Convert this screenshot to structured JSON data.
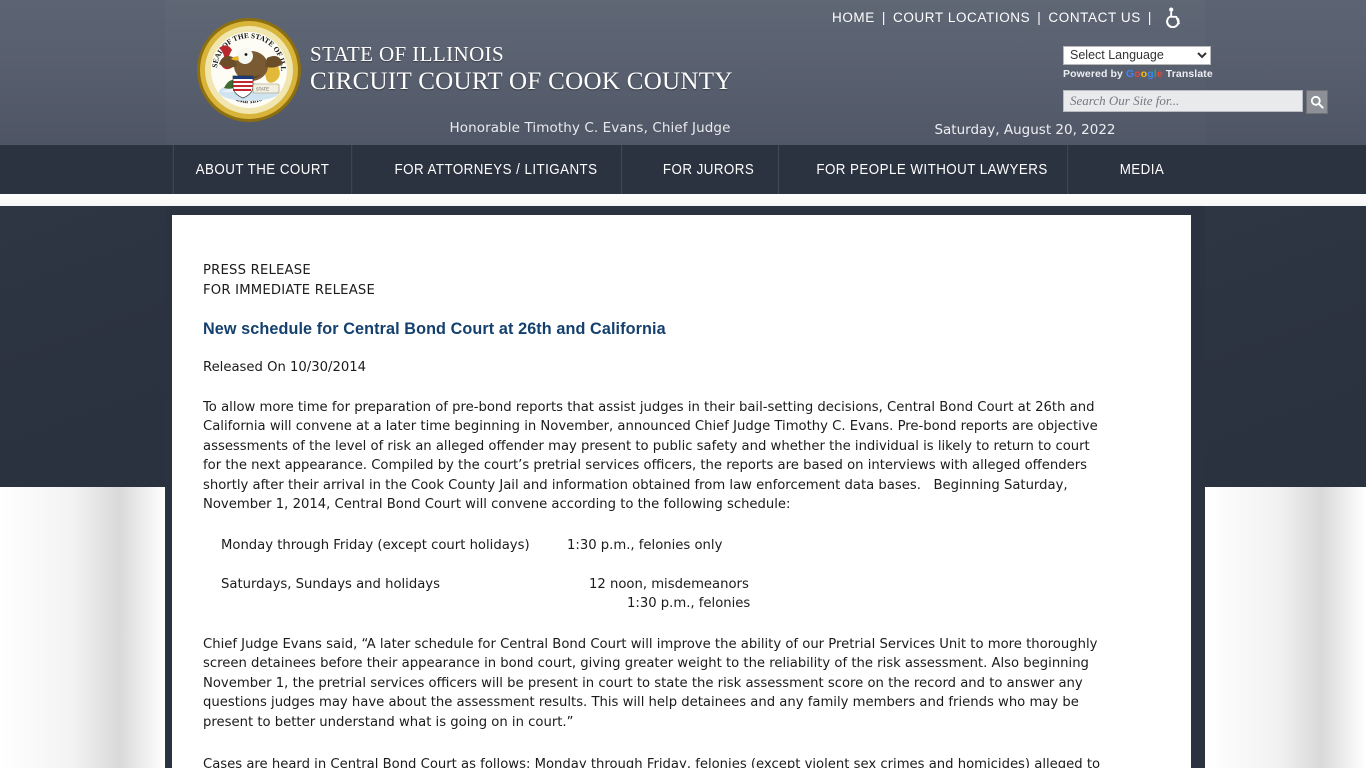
{
  "header": {
    "seal_alt": "Seal of the State of Illinois",
    "title_line1": "STATE OF ILLINOIS",
    "title_line2": "CIRCUIT COURT OF COOK COUNTY",
    "judge_line": "Honorable Timothy C. Evans, Chief Judge",
    "date": "Saturday, August 20, 2022",
    "top_links": [
      {
        "label": "HOME"
      },
      {
        "label": "COURT LOCATIONS"
      },
      {
        "label": "CONTACT US"
      }
    ],
    "separator": "|",
    "accessibility_icon": "wheelchair-accessibility-icon",
    "language": {
      "selected": "Select Language",
      "options": [
        "Select Language"
      ],
      "powered_by_prefix": "Powered by ",
      "google_letters": [
        "G",
        "o",
        "o",
        "g",
        "l",
        "e"
      ],
      "translate_label": " Translate"
    },
    "search": {
      "placeholder": "Search Our Site for...",
      "value": "",
      "button_icon": "search-icon"
    }
  },
  "nav": {
    "items": [
      {
        "label": "ABOUT THE COURT"
      },
      {
        "label": "FOR ATTORNEYS / LITIGANTS"
      },
      {
        "label": "FOR JURORS"
      },
      {
        "label": "FOR PEOPLE WITHOUT LAWYERS"
      },
      {
        "label": "MEDIA"
      }
    ]
  },
  "main": {
    "kicker_line1": "PRESS RELEASE",
    "kicker_line2": "FOR IMMEDIATE RELEASE",
    "title": "New schedule for Central Bond Court at 26th and California",
    "released_on": "Released On 10/30/2014",
    "paragraph1_lines": [
      "To allow more time for preparation of pre-bond reports that assist judges in their bail-setting decisions, Central Bond Court at 26th and",
      "California will convene at a later time beginning in November, announced Chief Judge Timothy C. Evans. Pre-bond reports are objective",
      "assessments of the level of risk an alleged offender may present to public safety and whether the individual is likely to return to court",
      "for the next appearance. Compiled by the court’s pretrial services officers, the reports are based on interviews with alleged offenders",
      "shortly after their arrival in the Cook County Jail and information obtained from law enforcement data bases.   Beginning Saturday,",
      "November 1, 2014, Central Bond Court will convene according to the following schedule:"
    ],
    "schedule": [
      {
        "days": "Monday through Friday (except court holidays)",
        "time1": "1:30 p.m., felonies only",
        "time2": ""
      },
      {
        "days": "Saturdays, Sundays and holidays",
        "time1": "12 noon, misdemeanors",
        "time2": "1:30 p.m., felonies"
      }
    ],
    "paragraph2_lines": [
      "Chief Judge Evans said, “A later schedule for Central Bond Court will improve the ability of our Pretrial Services Unit to more thoroughly",
      "screen detainees before their appearance in bond court, giving greater weight to the reliability of the risk assessment. Also beginning",
      "November 1, the pretrial services officers will be present in court to state the risk assessment score on the record and to answer any",
      "questions judges may have about the assessment results. This will help detainees and any family members and friends who may be",
      "present to better understand what is going on in court.”"
    ],
    "paragraph3_lines": [
      "Cases are heard in Central Bond Court as follows: Monday through Friday, felonies (except violent sex crimes and homicides) alleged to"
    ]
  },
  "colors": {
    "header_bg": "#5a6170",
    "nav_bg": "#2b3240",
    "title_accent": "#14406e",
    "card_bg": "#ffffff"
  }
}
